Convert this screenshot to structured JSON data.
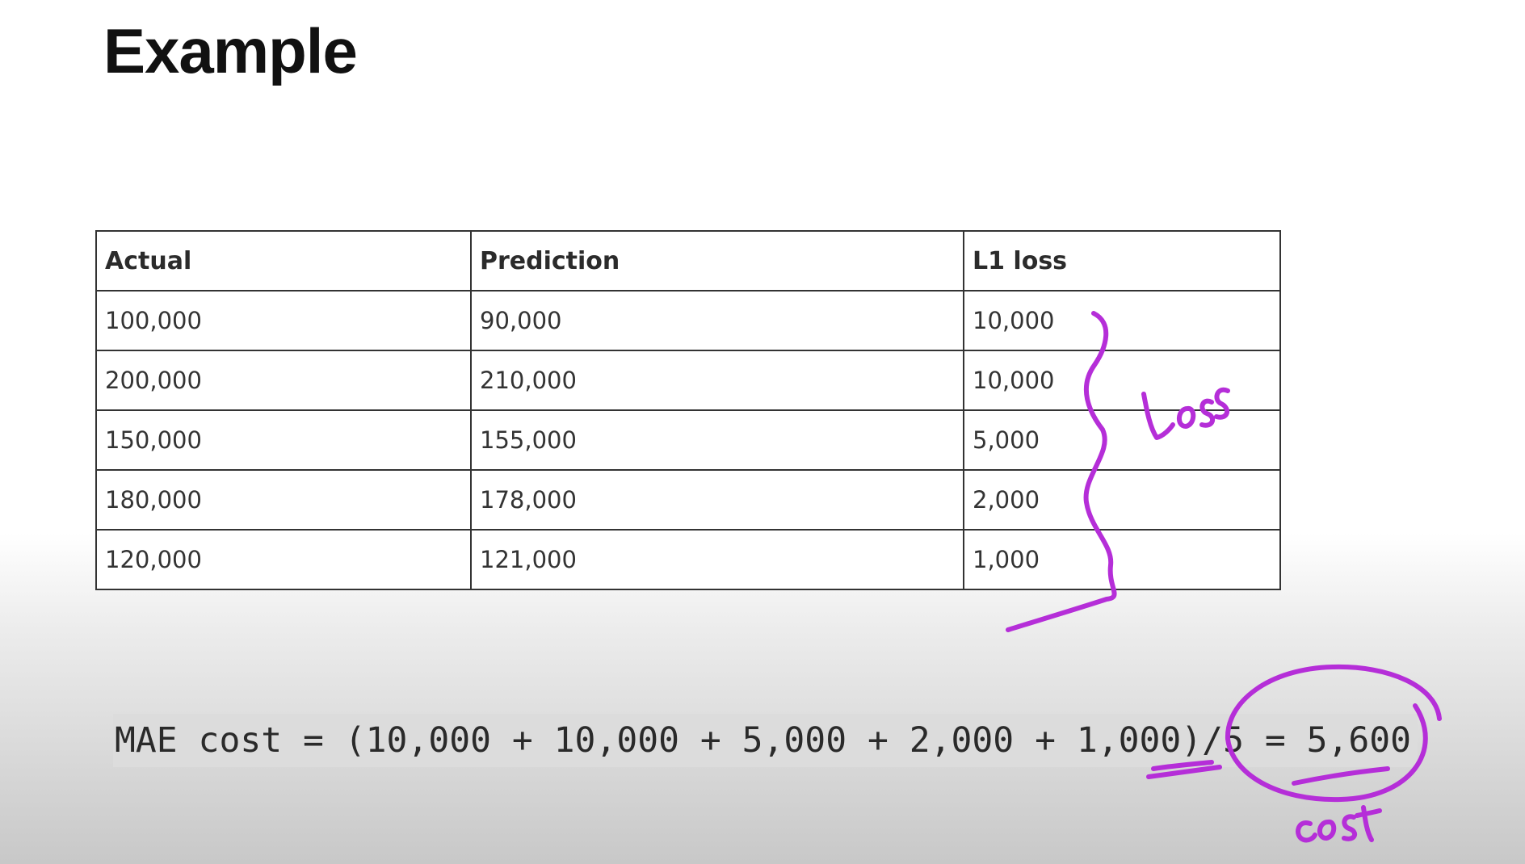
{
  "title": "Example",
  "table": {
    "headers": [
      "Actual",
      "Prediction",
      "L1 loss"
    ],
    "rows": [
      [
        "100,000",
        "90,000",
        "10,000"
      ],
      [
        "200,000",
        "210,000",
        "10,000"
      ],
      [
        "150,000",
        "155,000",
        "5,000"
      ],
      [
        "180,000",
        "178,000",
        "2,000"
      ],
      [
        "120,000",
        "121,000",
        "1,000"
      ]
    ]
  },
  "formula": "MAE cost = (10,000 + 10,000 + 5,000 + 2,000 + 1,000)/5 = 5,600",
  "annotations": {
    "loss_note": "Loss",
    "cost_note": "cost",
    "ink_color": "#b52ed8"
  }
}
